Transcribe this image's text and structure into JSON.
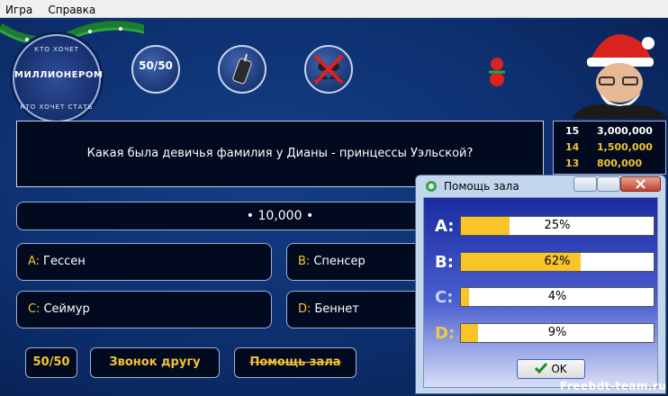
{
  "menu": {
    "items": [
      "Игра",
      "Справка"
    ]
  },
  "logo": {
    "top_text": "КТО ХОЧЕТ",
    "main_text": "МИЛЛИОНЕРОМ",
    "bottom_text": "КТО ХОЧЕТ СТАТЬ"
  },
  "lifelines_icons": {
    "fifty": {
      "label": "50/50",
      "icon": "fifty-fifty-icon"
    },
    "phone": {
      "icon": "phone-icon"
    },
    "audience": {
      "icon": "audience-used-icon"
    }
  },
  "question": {
    "text": "Какая была девичья фамилия у Дианы - принцессы Уэльской?"
  },
  "prize": {
    "text": "• 10,000 •"
  },
  "answers": [
    {
      "letter": "A:",
      "text": "Гессен"
    },
    {
      "letter": "B:",
      "text": "Спенсер"
    },
    {
      "letter": "C:",
      "text": "Сеймур"
    },
    {
      "letter": "D:",
      "text": "Беннет"
    }
  ],
  "buttons": {
    "fifty": "50/50",
    "phone": "Звонок другу",
    "audience": "Помощь зала"
  },
  "ladder": [
    {
      "n": "15",
      "v": "3,000,000"
    },
    {
      "n": "14",
      "v": "1,500,000"
    },
    {
      "n": "13",
      "v": "800,000"
    }
  ],
  "dialog": {
    "title": "Помощь зала",
    "ok_label": "OK",
    "votes": [
      {
        "letter": "A:",
        "pct_text": "25%",
        "pct": 25,
        "color": "#ffffff"
      },
      {
        "letter": "B:",
        "pct_text": "62%",
        "pct": 62,
        "color": "#ffffff"
      },
      {
        "letter": "C:",
        "pct_text": "4%",
        "pct": 4,
        "color": "#c9d2ef"
      },
      {
        "letter": "D:",
        "pct_text": "9%",
        "pct": 9,
        "color": "#f0c84a"
      }
    ]
  },
  "watermark": "Freebdt-team.ru",
  "colors": {
    "accent": "#f4c430",
    "background": "#0d2f6e",
    "bar_fill": "#f8c42a"
  }
}
